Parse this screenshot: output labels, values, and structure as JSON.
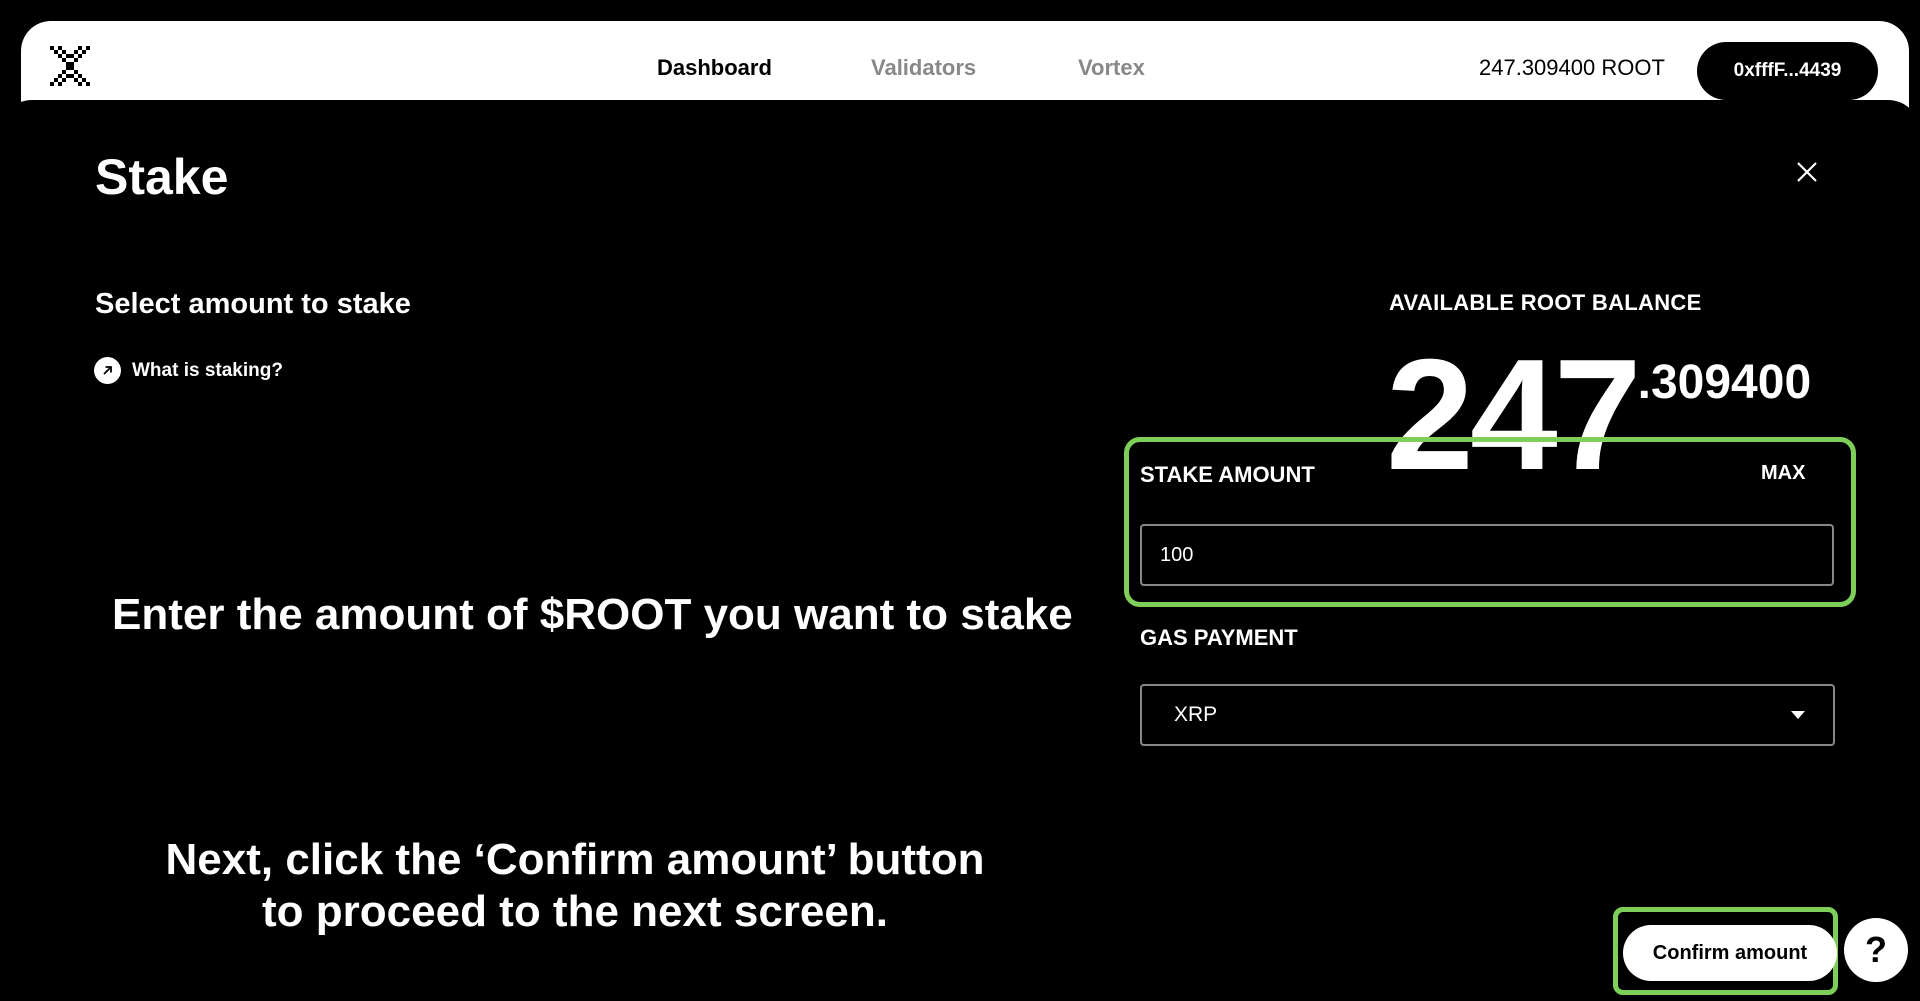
{
  "nav": {
    "logo_icon": "pixel-x-logo-icon",
    "items": [
      {
        "label": "Dashboard",
        "active": true
      },
      {
        "label": "Validators",
        "active": false
      },
      {
        "label": "Vortex",
        "active": false
      }
    ],
    "balance": "247.309400 ROOT",
    "wallet_address": "0xfffF...4439"
  },
  "modal": {
    "title": "Stake",
    "close_icon": "close-icon",
    "section_label": "Select amount to stake",
    "help_link": {
      "icon": "arrow-up-right-icon",
      "label": "What is staking?"
    },
    "available": {
      "label": "AVAILABLE ROOT BALANCE",
      "integer": "247",
      "decimal": ".309400"
    },
    "stake_amount": {
      "label": "STAKE AMOUNT",
      "max_label": "MAX",
      "value": "100"
    },
    "gas_payment": {
      "label": "GAS PAYMENT",
      "selected": "XRP",
      "caret_icon": "caret-down-icon"
    },
    "confirm_button": "Confirm amount"
  },
  "annotations": {
    "instruction_1": "Enter the amount of $ROOT you want to stake",
    "instruction_2": "Next, click the ‘Confirm amount’ button to proceed to the next screen.",
    "highlight_color": "#7ecf5a"
  },
  "help_fab": {
    "label": "?"
  }
}
